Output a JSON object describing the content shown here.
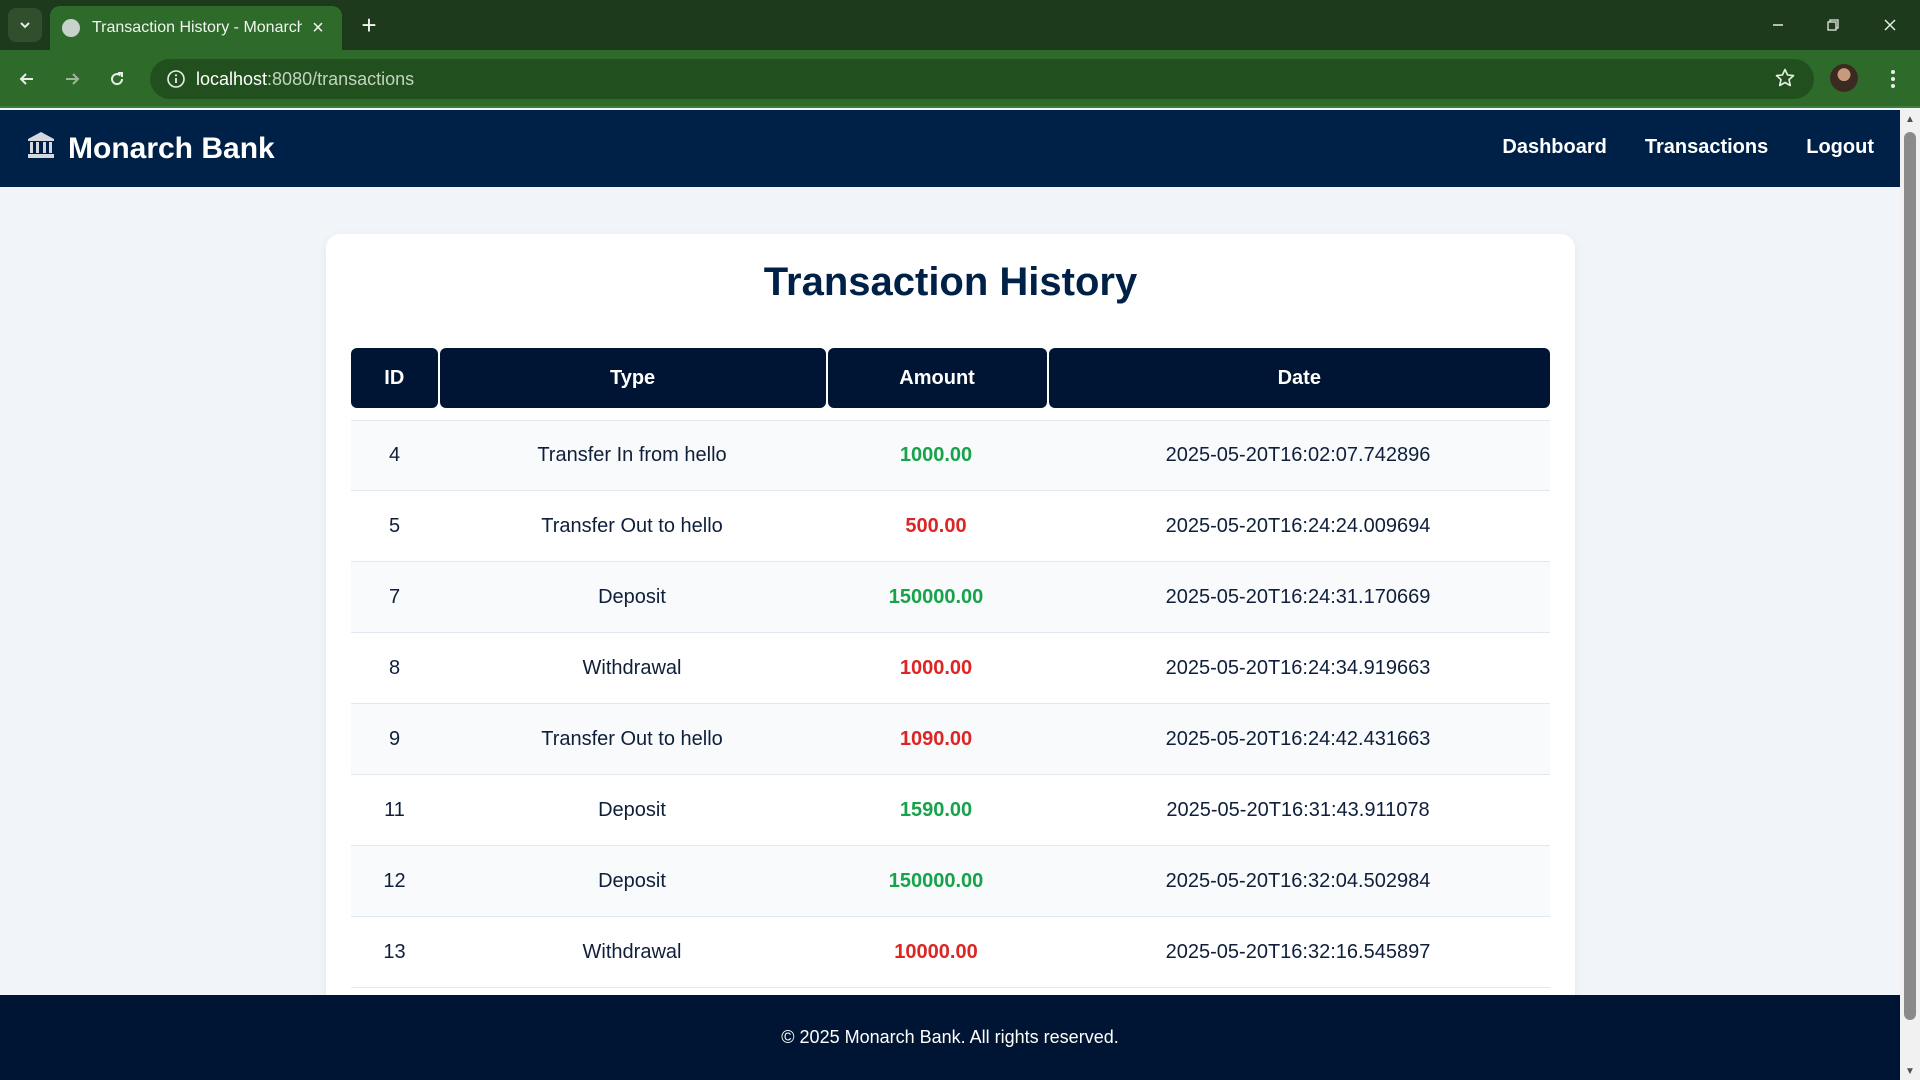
{
  "browser": {
    "tab_title": "Transaction History - Monarch Bank",
    "url_host": "localhost",
    "url_rest": ":8080/transactions"
  },
  "header": {
    "brand": "Monarch Bank",
    "nav": [
      "Dashboard",
      "Transactions",
      "Logout"
    ]
  },
  "page": {
    "title": "Transaction History"
  },
  "table": {
    "columns": [
      "ID",
      "Type",
      "Amount",
      "Date"
    ],
    "rows": [
      {
        "id": "4",
        "type": "Transfer In from hello",
        "amount": "1000.00",
        "date": "2025-05-20T16:02:07.742896",
        "color": "#16a34a"
      },
      {
        "id": "5",
        "type": "Transfer Out to hello",
        "amount": "500.00",
        "date": "2025-05-20T16:24:24.009694",
        "color": "#dc2626"
      },
      {
        "id": "7",
        "type": "Deposit",
        "amount": "150000.00",
        "date": "2025-05-20T16:24:31.170669",
        "color": "#16a34a"
      },
      {
        "id": "8",
        "type": "Withdrawal",
        "amount": "1000.00",
        "date": "2025-05-20T16:24:34.919663",
        "color": "#dc2626"
      },
      {
        "id": "9",
        "type": "Transfer Out to hello",
        "amount": "1090.00",
        "date": "2025-05-20T16:24:42.431663",
        "color": "#dc2626"
      },
      {
        "id": "11",
        "type": "Deposit",
        "amount": "1590.00",
        "date": "2025-05-20T16:31:43.911078",
        "color": "#16a34a"
      },
      {
        "id": "12",
        "type": "Deposit",
        "amount": "150000.00",
        "date": "2025-05-20T16:32:04.502984",
        "color": "#16a34a"
      },
      {
        "id": "13",
        "type": "Withdrawal",
        "amount": "10000.00",
        "date": "2025-05-20T16:32:16.545897",
        "color": "#dc2626"
      }
    ]
  },
  "footer": {
    "text": "© 2025 Monarch Bank. All rights reserved."
  },
  "icons": {
    "bank": "bank-icon",
    "info": "info-icon",
    "star": "star-icon"
  },
  "colors": {
    "brand_navy": "#002147",
    "positive": "#16a34a",
    "negative": "#dc2626"
  }
}
